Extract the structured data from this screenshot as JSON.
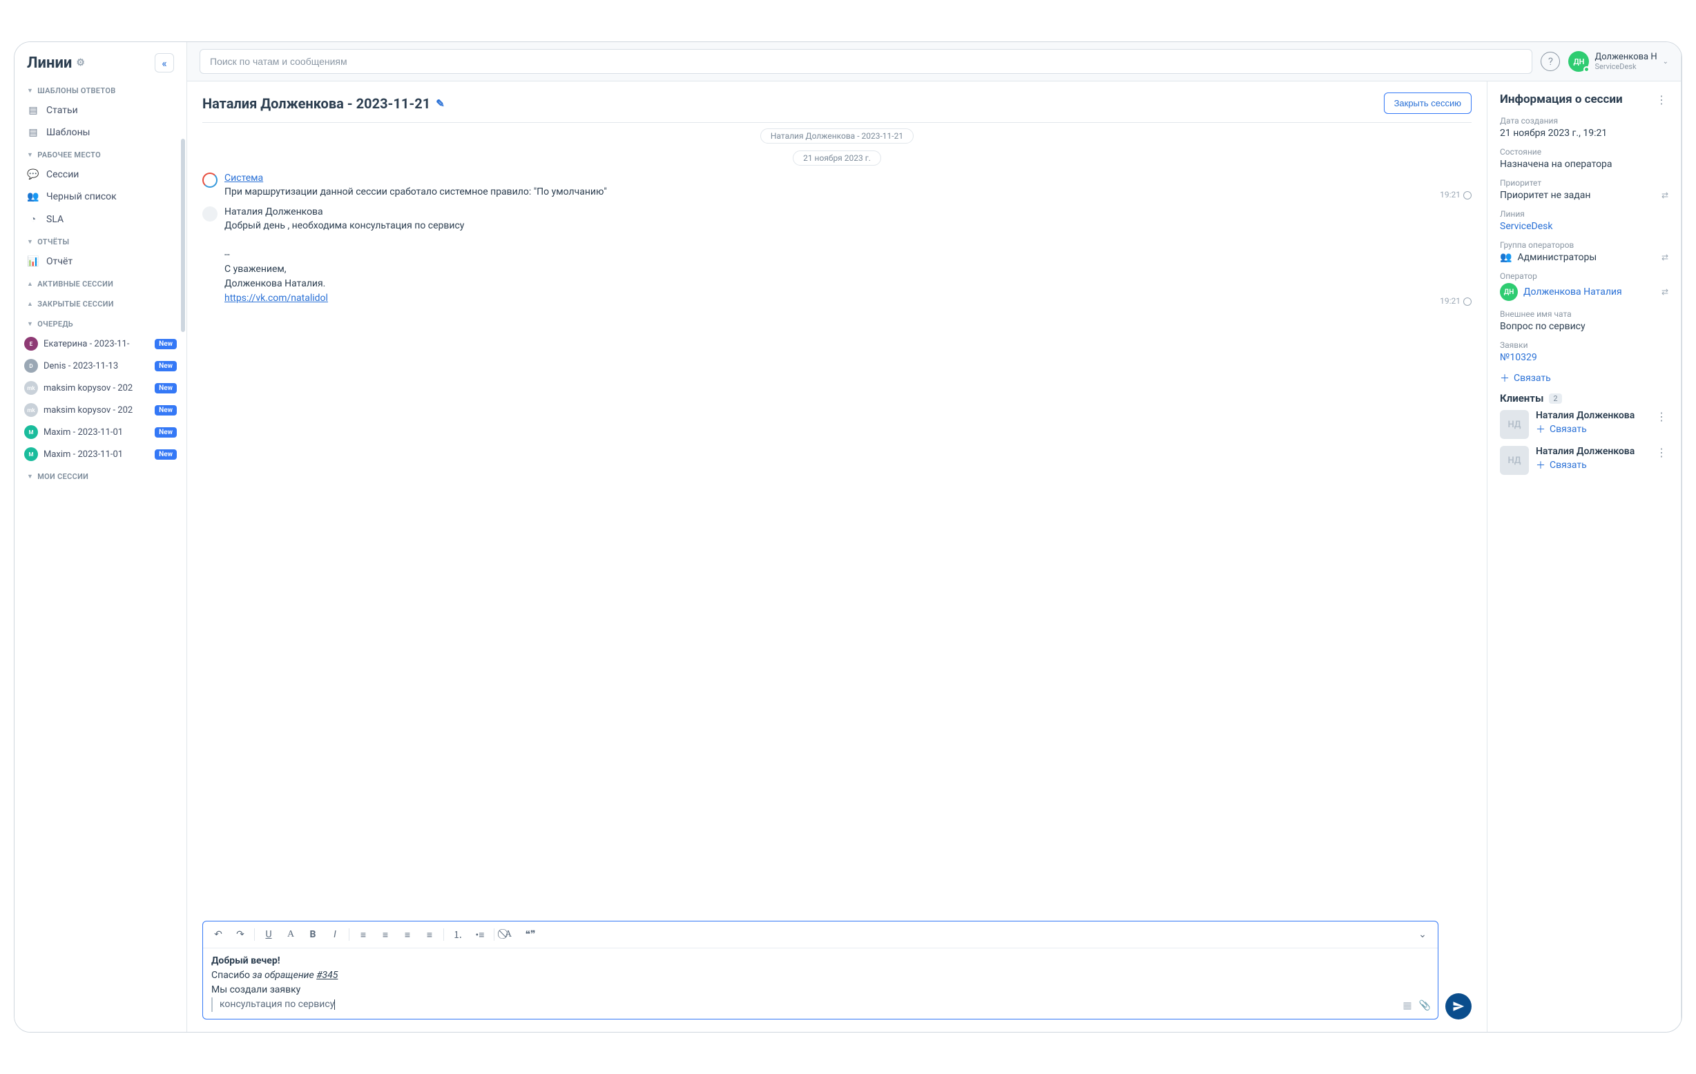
{
  "brand": "Линии",
  "search": {
    "placeholder": "Поиск по чатам и сообщениям"
  },
  "user": {
    "initials": "ДН",
    "name": "Долженкова Н",
    "sub": "ServiceDesk"
  },
  "sidebar": {
    "sections": {
      "templates": {
        "title": "ШАБЛОНЫ ОТВЕТОВ",
        "items": [
          {
            "label": "Статьи"
          },
          {
            "label": "Шаблоны"
          }
        ]
      },
      "workplace": {
        "title": "РАБОЧЕЕ МЕСТО",
        "items": [
          {
            "label": "Сессии"
          },
          {
            "label": "Черный список"
          },
          {
            "label": "SLA"
          }
        ]
      },
      "reports": {
        "title": "ОТЧЁТЫ",
        "items": [
          {
            "label": "Отчёт"
          }
        ]
      },
      "active": {
        "title": "АКТИВНЫЕ СЕССИИ"
      },
      "closed": {
        "title": "ЗАКРЫТЫЕ СЕССИИ"
      },
      "queue": {
        "title": "ОЧЕРЕДЬ",
        "items": [
          {
            "avatar": "Е",
            "color": "#8e3a74",
            "label": "Екатерина - 2023-11-",
            "badge": "New"
          },
          {
            "avatar": "D",
            "color": "#9aa7b4",
            "label": "Denis - 2023-11-13",
            "badge": "New"
          },
          {
            "avatar": "mk",
            "color": "#c9d1d9",
            "label": "maksim kopysov - 202",
            "badge": "New"
          },
          {
            "avatar": "mk",
            "color": "#c9d1d9",
            "label": "maksim kopysov - 202",
            "badge": "New"
          },
          {
            "avatar": "M",
            "color": "#1abc9c",
            "label": "Maxim - 2023-11-01",
            "badge": "New"
          },
          {
            "avatar": "M",
            "color": "#1abc9c",
            "label": "Maxim - 2023-11-01",
            "badge": "New"
          }
        ]
      },
      "my": {
        "title": "МОИ СЕССИИ"
      }
    }
  },
  "chat": {
    "title": "Наталия Долженкова - 2023-11-21",
    "close_btn": "Закрыть сессию",
    "pill_label": "Наталия Долженкова - 2023-11-21",
    "date_label": "21 ноября 2023 г.",
    "messages": [
      {
        "system": true,
        "name": "Система",
        "text": "При маршрутизации данной сессии сработало системное правило: \"По умолчанию\"",
        "time": "19:21"
      },
      {
        "system": false,
        "name": "Наталия Долженкова",
        "text_lines": [
          "Добрый день , необходима консультация по сервису",
          "",
          "--",
          "С уважением,",
          "Долженкова Наталия."
        ],
        "link": "https://vk.com/natalidol",
        "time": "19:21"
      }
    ]
  },
  "composer": {
    "line1_bold": "Добрый вечер!",
    "line2_pre": "Спасибо ",
    "line2_italic": "за обращение ",
    "line2_under": "#345",
    "line3": "Мы создали заявку",
    "quote": "консультация по сервису"
  },
  "info": {
    "title": "Информация о сессии",
    "created_label": "Дата создания",
    "created_value": "21 ноября 2023 г., 19:21",
    "state_label": "Состояние",
    "state_value": "Назначена на оператора",
    "priority_label": "Приоритет",
    "priority_value": "Приоритет не задан",
    "line_label": "Линия",
    "line_value": "ServiceDesk",
    "group_label": "Группа операторов",
    "group_value": "Администраторы",
    "operator_label": "Оператор",
    "operator_initials": "ДН",
    "operator_value": "Долженкова Наталия",
    "extname_label": "Внешнее имя чата",
    "extname_value": "Вопрос по сервису",
    "tickets_label": "Заявки",
    "tickets_value": "№10329",
    "link_action": "Связать",
    "clients_title": "Клиенты",
    "clients_count": "2",
    "clients": [
      {
        "initials": "НД",
        "name": "Наталия Долженкова"
      },
      {
        "initials": "НД",
        "name": "Наталия Долженкова"
      }
    ]
  }
}
